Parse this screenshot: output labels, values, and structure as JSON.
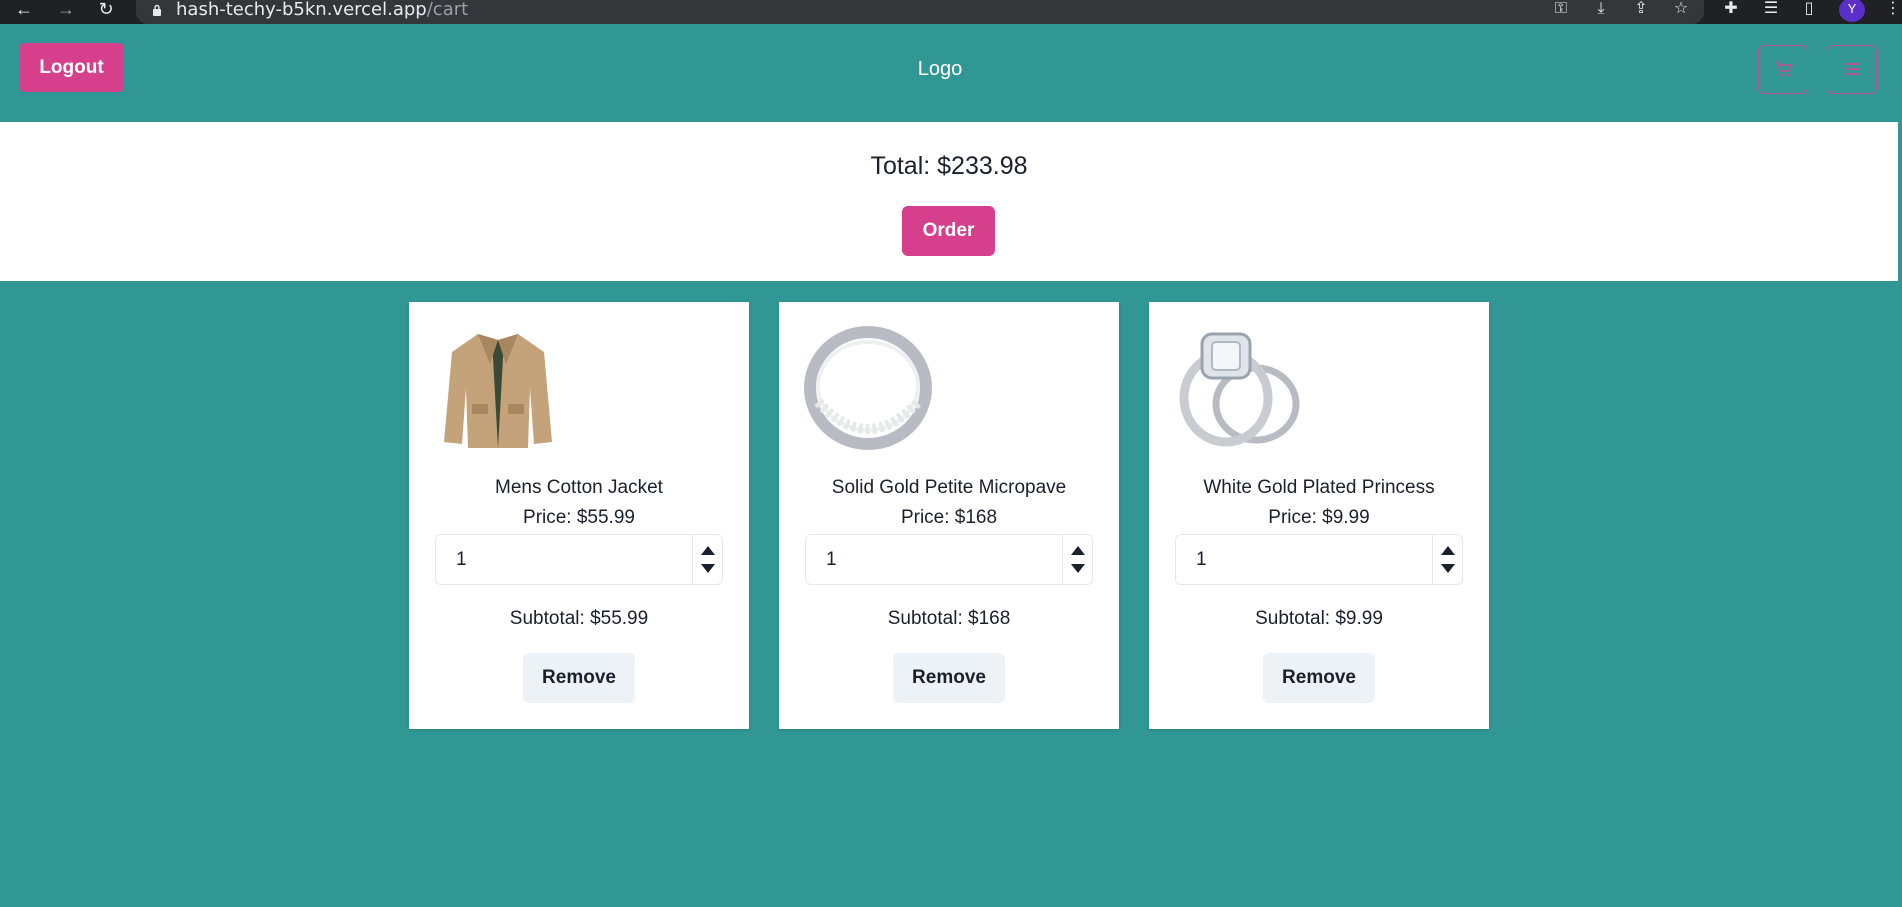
{
  "browser": {
    "url_host": "hash-techy-b5kn.vercel.app",
    "url_path": "/cart",
    "avatar_letter": "Y"
  },
  "navbar": {
    "logout_label": "Logout",
    "logo_text": "Logo"
  },
  "summary": {
    "total_text": "Total: $233.98",
    "order_label": "Order"
  },
  "cart": {
    "items": [
      {
        "title": "Mens Cotton Jacket",
        "price": "Price: $55.99",
        "quantity": "1",
        "subtotal": "Subtotal: $55.99",
        "remove_label": "Remove",
        "image": "jacket"
      },
      {
        "title": "Solid Gold Petite Micropave",
        "price": "Price: $168",
        "quantity": "1",
        "subtotal": "Subtotal: $168",
        "remove_label": "Remove",
        "image": "ring-band"
      },
      {
        "title": "White Gold Plated Princess",
        "price": "Price: $9.99",
        "quantity": "1",
        "subtotal": "Subtotal: $9.99",
        "remove_label": "Remove",
        "image": "ring-set"
      }
    ]
  },
  "colors": {
    "page_background": "#319795",
    "accent_pink": "#d53f8c",
    "card_background": "#ffffff",
    "remove_button": "#edf2f7"
  }
}
